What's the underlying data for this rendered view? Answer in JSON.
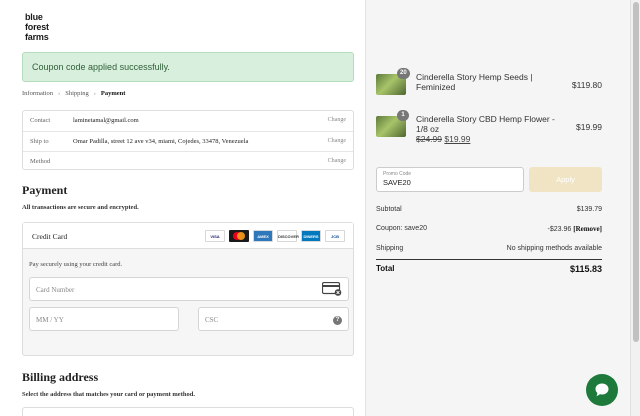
{
  "logo": {
    "line1": "blue",
    "line2": "forest",
    "line3": "farms"
  },
  "alert": {
    "text": "Coupon code applied successfully."
  },
  "breadcrumb": {
    "items": [
      "Information",
      "Shipping",
      "Payment"
    ]
  },
  "review": {
    "rows": [
      {
        "label": "Contact",
        "value": "laminetamal@gmail.com",
        "action": "Change"
      },
      {
        "label": "Ship to",
        "value": "Omar Padilla, street 12 ave v34, miami, Cojedes, 33478, Venezuela",
        "action": "Change"
      },
      {
        "label": "Method",
        "value": "",
        "action": "Change"
      }
    ]
  },
  "payment": {
    "heading": "Payment",
    "subheading": "All transactions are secure and encrypted.",
    "method_label": "Credit Card",
    "card_brands": [
      {
        "name": "VISA",
        "color": "#1a1f71",
        "bg": "#ffffff"
      },
      {
        "name": "MC",
        "color": "#eb001b",
        "bg": "#ffffff"
      },
      {
        "name": "AMEX",
        "color": "#ffffff",
        "bg": "#2e77bb"
      },
      {
        "name": "DISCOVER",
        "color": "#333333",
        "bg": "#ffffff"
      },
      {
        "name": "DINERS",
        "color": "#ffffff",
        "bg": "#0079be"
      },
      {
        "name": "JCB",
        "color": "#0e4c96",
        "bg": "#ffffff"
      }
    ],
    "description": "Pay securely using your credit card.",
    "card_number_placeholder": "Card Number",
    "expiry_placeholder": "MM / YY",
    "csc_placeholder": "CSC"
  },
  "billing": {
    "heading": "Billing address",
    "subheading": "Select the address that matches your card or payment method."
  },
  "cart": {
    "items": [
      {
        "qty": "20",
        "name": "Cinderella Story Hemp Seeds | Feminized",
        "price": "$119.80"
      },
      {
        "qty": "1",
        "name": "Cinderella Story CBD Hemp Flower - 1/8 oz",
        "old_price": "$24.99",
        "new_price": "$19.99",
        "price": "$19.99"
      }
    ],
    "promo_placeholder": "Promo Code",
    "promo_value": "SAVE20",
    "apply_label": "Apply",
    "subtotal_label": "Subtotal",
    "subtotal_value": "$139.79",
    "coupon_label": "Coupon: save20",
    "coupon_value": "-$23.96",
    "remove_label": "[Remove]",
    "shipping_label": "Shipping",
    "shipping_value": "No shipping methods available",
    "total_label": "Total",
    "total_value": "$115.83"
  },
  "colors": {
    "accent": "#1e7a3a",
    "alert_bg": "#d9efdd",
    "apply_bg": "#f0e4c4"
  }
}
